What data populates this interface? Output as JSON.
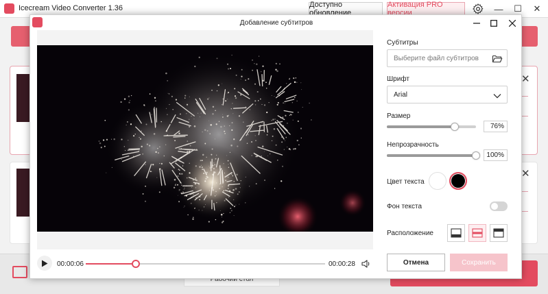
{
  "app": {
    "title": "Icecream Video Converter 1.36",
    "update_button": "Доступно обновление",
    "pro_button": "Активация PRO версии",
    "desktop_label": "Рабочий стол",
    "accent": "#e34b5f"
  },
  "dialog": {
    "title": "Добавление субтитров",
    "subtitles": {
      "label": "Субтитры",
      "placeholder": "Выберите файл субтитров"
    },
    "font": {
      "label": "Шрифт",
      "value": "Arial"
    },
    "size": {
      "label": "Размер",
      "value_text": "76%",
      "value": 0.76
    },
    "opacity": {
      "label": "Непрозрачность",
      "value_text": "100%",
      "value": 1.0
    },
    "text_color": {
      "label": "Цвет текста",
      "options": [
        "#ffffff",
        "#000000"
      ],
      "selected": "#000000"
    },
    "text_background": {
      "label": "Фон текста",
      "enabled": false
    },
    "position": {
      "label": "Расположение",
      "options": [
        "bottom",
        "middle",
        "top"
      ],
      "selected": "middle"
    },
    "cancel_button": "Отмена",
    "save_button": "Сохранить"
  },
  "player": {
    "current_time": "00:00:06",
    "total_time": "00:00:28",
    "progress": 0.21
  }
}
